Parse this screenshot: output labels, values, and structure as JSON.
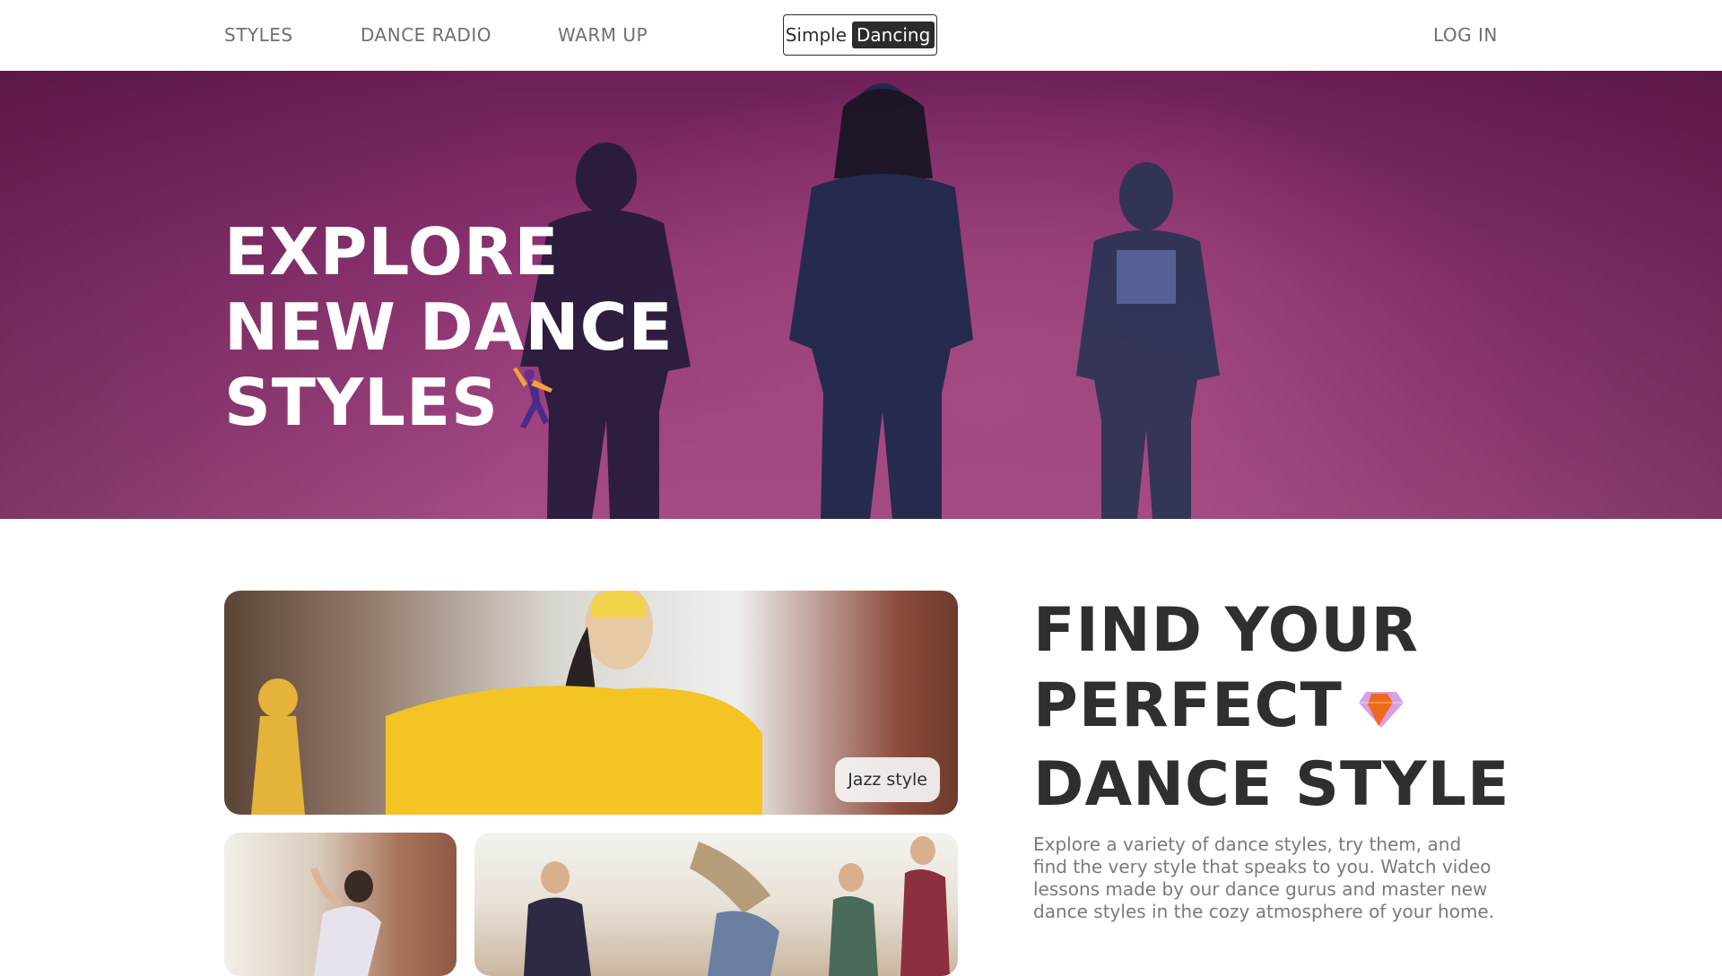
{
  "nav": {
    "links": [
      "STYLES",
      "DANCE RADIO",
      "WARM UP"
    ],
    "logo_part1": "Simple",
    "logo_part2": "Dancing",
    "login": "LOG IN"
  },
  "hero": {
    "title_lines": [
      "EXPLORE",
      "NEW DANCE",
      "STYLES"
    ],
    "icon": "dancer-icon"
  },
  "gallery": {
    "featured_label": "Jazz style"
  },
  "section": {
    "title_lines": [
      "FIND YOUR",
      "PERFECT",
      "DANCE STYLE"
    ],
    "icon": "gem-icon",
    "description": "Explore a variety of dance styles, try them, and find the very style that speaks to you. Watch video lessons made by our dance gurus and master new dance styles in the cozy atmosphere of your home."
  },
  "colors": {
    "hero_bg": "#8d3472",
    "text_dark": "#2c2c2c",
    "text_muted": "#7a7a7a"
  }
}
